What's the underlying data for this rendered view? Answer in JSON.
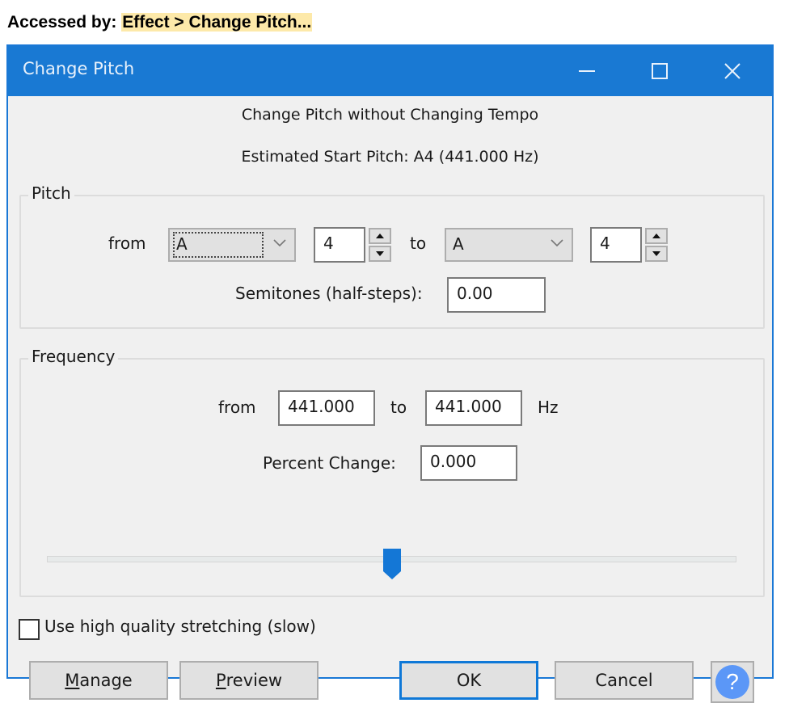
{
  "caption": {
    "prefix": "Accessed by: ",
    "path": "Effect > Change Pitch..."
  },
  "window": {
    "title": "Change Pitch",
    "controls": {
      "minimize": "minimize-icon",
      "maximize": "maximize-icon",
      "close": "close-icon"
    }
  },
  "header": {
    "subtitle": "Change Pitch without Changing Tempo",
    "estimated_pitch": "Estimated Start Pitch: A4 (441.000 Hz)"
  },
  "pitch": {
    "group_label": "Pitch",
    "from_label": "from",
    "from_note": "A",
    "from_octave": "4",
    "to_label": "to",
    "to_note": "A",
    "to_octave": "4",
    "semitones_label": "Semitones (half-steps):",
    "semitones_value": "0.00"
  },
  "frequency": {
    "group_label": "Frequency",
    "from_label": "from",
    "from_value": "441.000",
    "to_label": "to",
    "to_value": "441.000",
    "unit": "Hz",
    "percent_label": "Percent Change:",
    "percent_value": "0.000",
    "slider_position_fraction": 0.5
  },
  "options": {
    "high_quality_label": "Use high quality stretching (slow)",
    "high_quality_checked": false
  },
  "buttons": {
    "manage_mnemonic": "M",
    "manage_rest": "anage",
    "preview_mnemonic": "P",
    "preview_rest": "review",
    "ok": "OK",
    "cancel": "Cancel",
    "help": "?"
  },
  "colors": {
    "titlebar": "#1979d3",
    "accent": "#0f78d7",
    "help_icon": "#5b97f7",
    "highlight": "#fde9a9"
  }
}
